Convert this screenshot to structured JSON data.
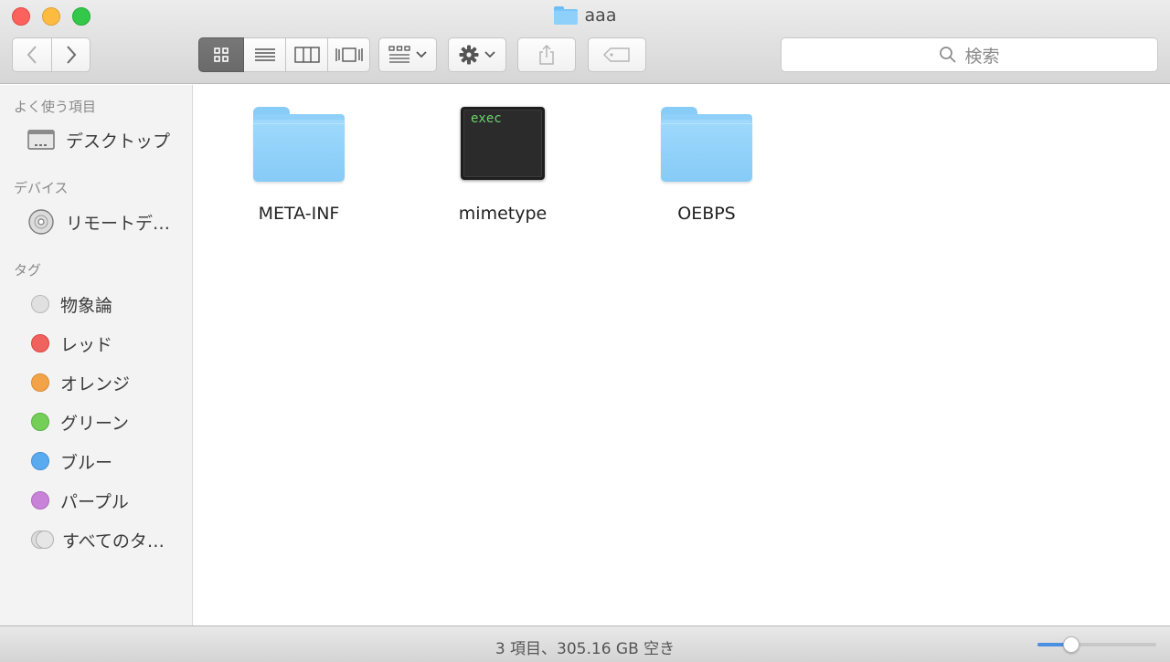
{
  "window": {
    "title": "aaa"
  },
  "toolbar": {
    "search_placeholder": "検索",
    "view_modes": [
      "icon",
      "list",
      "column",
      "coverflow"
    ],
    "selected_view": "icon"
  },
  "sidebar": {
    "favorites": {
      "header": "よく使う項目",
      "items": [
        {
          "label": "デスクトップ",
          "icon": "desktop-icon"
        }
      ]
    },
    "devices": {
      "header": "デバイス",
      "items": [
        {
          "label": "リモートデ…",
          "icon": "disc-icon"
        }
      ]
    },
    "tags": {
      "header": "タグ",
      "items": [
        {
          "label": "物象論",
          "color": "#e0e0e0"
        },
        {
          "label": "レッド",
          "color": "#f0625e"
        },
        {
          "label": "オレンジ",
          "color": "#f3a347"
        },
        {
          "label": "グリーン",
          "color": "#74cf58"
        },
        {
          "label": "ブルー",
          "color": "#5aaaf0"
        },
        {
          "label": "パープル",
          "color": "#c883d9"
        },
        {
          "label": "すべてのタ…",
          "color": "#dddddd"
        }
      ]
    }
  },
  "files": [
    {
      "name": "META-INF",
      "type": "folder"
    },
    {
      "name": "mimetype",
      "type": "exec",
      "badge": "exec"
    },
    {
      "name": "OEBPS",
      "type": "folder"
    }
  ],
  "status": {
    "text": "3 項目、305.16 GB 空き",
    "zoom": 0.25
  }
}
